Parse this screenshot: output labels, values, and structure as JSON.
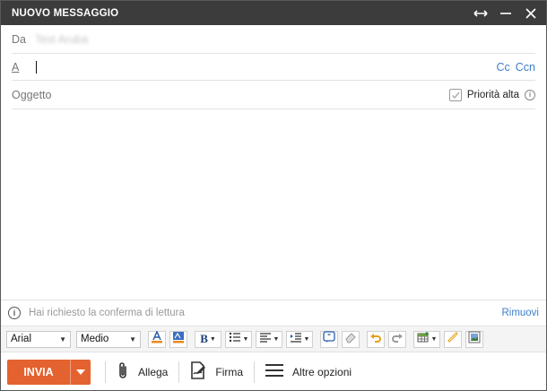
{
  "window": {
    "title": "NUOVO MESSAGGIO"
  },
  "from": {
    "label": "Da",
    "value": "Test Aruba"
  },
  "to": {
    "label": "A",
    "value": "",
    "cc": "Cc",
    "ccn": "Ccn"
  },
  "subject": {
    "placeholder": "Oggetto",
    "priority_label": "Priorità alta"
  },
  "receipt": {
    "text": "Hai richiesto la conferma di lettura",
    "remove": "Rimuovi"
  },
  "toolbar": {
    "font": "Arial",
    "size": "Medio"
  },
  "actions": {
    "send": "INVIA",
    "attach": "Allega",
    "signature": "Firma",
    "more": "Altre opzioni"
  },
  "colors": {
    "titlebar": "#3c3c3c",
    "send": "#e4622f",
    "link": "#3d7ec8"
  }
}
